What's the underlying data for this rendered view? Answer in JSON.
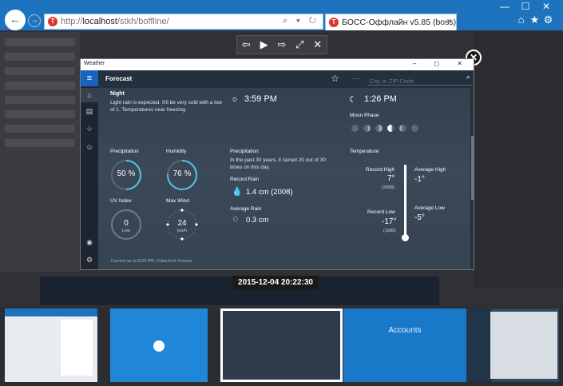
{
  "browser": {
    "url_prefix": "http://",
    "url_host": "localhost",
    "url_path": "/stkh/boffline/",
    "tab_title": "БОСС-Оффлайн v5.85 (boss)",
    "tab_close": "×",
    "addr_controls": "⌕ ▾ ↻",
    "window_controls": [
      "—",
      "☐",
      "✕"
    ],
    "tool_icons": [
      "⌂",
      "★",
      "⚙"
    ]
  },
  "viewer": {
    "controls": [
      "⇦",
      "▶",
      "⇨",
      "⤢",
      "✕"
    ],
    "close": "✕",
    "timestamp": "2015-12-04 20:22:30"
  },
  "weather": {
    "window_title": "Weather",
    "window_controls": "–  ◻  ✕",
    "header_title": "Forecast",
    "search_placeholder": "City or ZIP Code",
    "sections": {
      "night_title": "Night",
      "night_text": "Light rain is expected. It'll be very cold with a low of 1. Temperatures near freezing.",
      "sunset_time": "3:59 PM",
      "moonset_time": "1:26 PM",
      "moon_phase_label": "Moon Phase",
      "precip_label": "Precipitation",
      "precip_value": "50 %",
      "precip_fraction": 0.5,
      "humidity_label": "Humidity",
      "humidity_value": "76 %",
      "humidity_fraction": 0.76,
      "uv_label": "UV Index",
      "uv_value": "0",
      "uv_unit": "Low",
      "wind_label": "Max Wind",
      "wind_value": "24",
      "wind_unit": "km/h",
      "hist_precip_label": "Precipitation",
      "hist_precip_text": "In the past 30 years, it rained 20 out of 30 times on this day.",
      "record_rain_label": "Record Rain",
      "record_rain_value": "1.4 cm (2008)",
      "avg_rain_label": "Average Rain",
      "avg_rain_value": "0.3 cm",
      "temp_label": "Temperature",
      "record_high_label": "Record High",
      "record_high_value": "7°",
      "record_high_year": "(2008)",
      "avg_high_label": "Average High",
      "avg_high_value": "-1°",
      "record_low_label": "Record Low",
      "record_low_value": "-17°",
      "record_low_year": "(1985)",
      "avg_low_label": "Average Low",
      "avg_low_value": "-5°"
    },
    "footer": "Current as of 8:00 PM  |  Data from Foreca"
  },
  "filmstrip": {
    "accounts_label": "Accounts"
  },
  "colors": {
    "browser_blue": "#1e73be",
    "gauge_accent": "#4fc3e8"
  }
}
